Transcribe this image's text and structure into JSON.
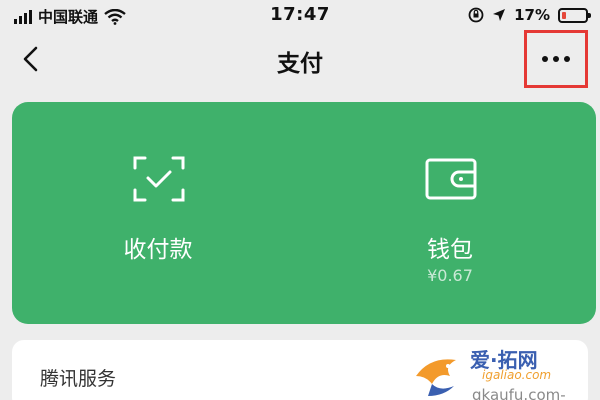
{
  "status_bar": {
    "carrier": "中国联通",
    "time": "17:47",
    "battery_percent": "17%",
    "battery_level": 0.17
  },
  "nav": {
    "title": "支付",
    "back_icon": "chevron-left-icon",
    "more_icon": "more-dots-icon"
  },
  "pay_card": {
    "color": "#3fb16b",
    "actions": [
      {
        "label": "收付款",
        "icon": "scan-check-icon"
      },
      {
        "label": "钱包",
        "sub": "¥0.67",
        "icon": "wallet-icon"
      }
    ]
  },
  "services": {
    "title": "腾讯服务"
  },
  "watermark": {
    "line1": "爱·拓网",
    "line2": "igaliao.com",
    "line3": "qkaufu.com-"
  }
}
